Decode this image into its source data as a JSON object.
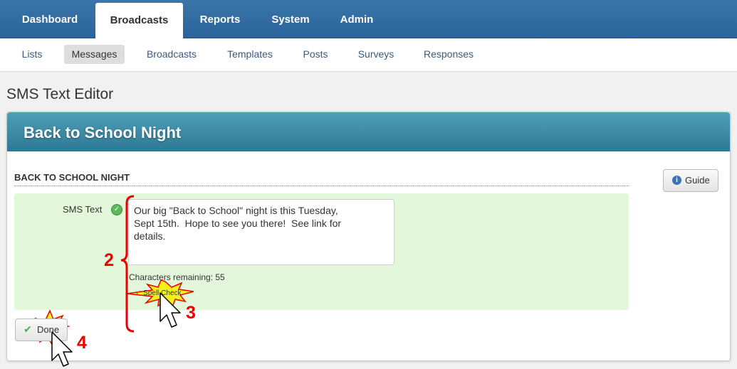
{
  "topnav": {
    "tabs": [
      {
        "label": "Dashboard"
      },
      {
        "label": "Broadcasts"
      },
      {
        "label": "Reports"
      },
      {
        "label": "System"
      },
      {
        "label": "Admin"
      }
    ]
  },
  "subnav": {
    "items": [
      {
        "label": "Lists"
      },
      {
        "label": "Messages"
      },
      {
        "label": "Broadcasts"
      },
      {
        "label": "Templates"
      },
      {
        "label": "Posts"
      },
      {
        "label": "Surveys"
      },
      {
        "label": "Responses"
      }
    ]
  },
  "page": {
    "title": "SMS Text Editor"
  },
  "panel": {
    "title": "Back to School Night",
    "section_heading": "BACK TO SCHOOL NIGHT",
    "guide_label": "Guide",
    "sms_label": "SMS Text",
    "sms_value": "Our big \"Back to School\" night is this Tuesday,\nSept 15th.  Hope to see you there!  See link for\ndetails.",
    "characters_remaining": "Characters remaining: 55",
    "spell_check_label": "Spell Check",
    "done_label": "Done"
  },
  "annotations": {
    "step2": "2",
    "step3": "3",
    "step4": "4"
  },
  "colors": {
    "nav_blue": "#2b639a",
    "panel_header": "#2e7894",
    "form_bg": "#e3f7da",
    "annotation_red": "#e00000",
    "burst_yellow": "#f2f21a"
  }
}
